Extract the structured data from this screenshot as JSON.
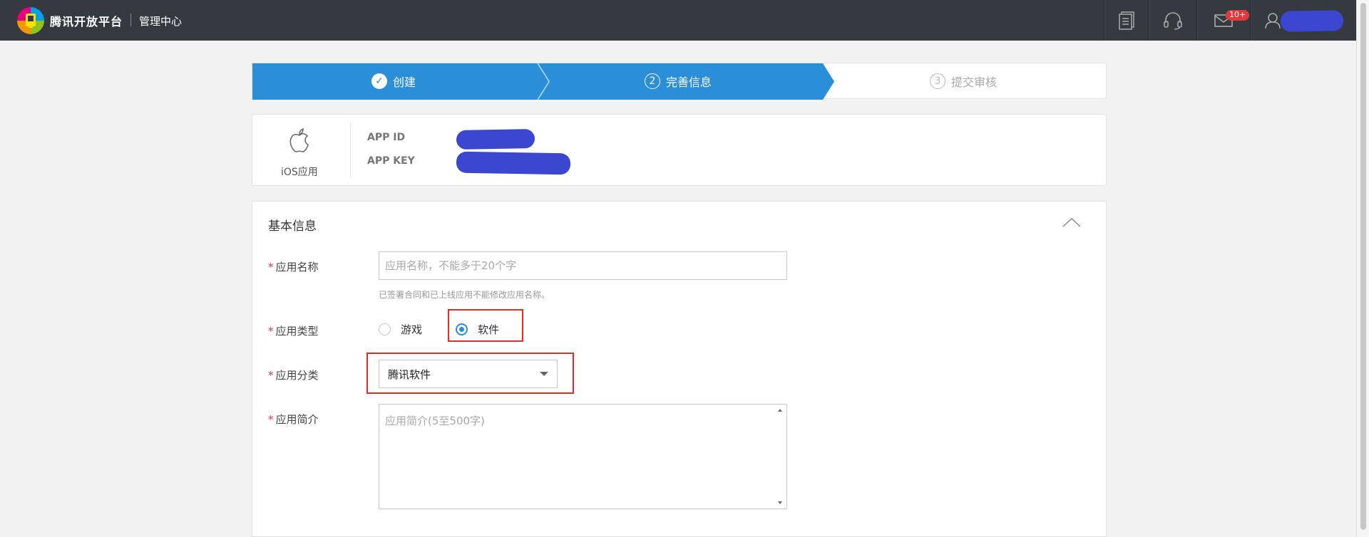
{
  "header": {
    "brand": "腾讯开放平台",
    "subtitle": "管理中心",
    "icons": [
      "document-icon",
      "headset-icon",
      "mail-icon",
      "user-icon"
    ],
    "mail_badge": "10+"
  },
  "steps": [
    {
      "label": "创建",
      "marker": "✓",
      "state": "done"
    },
    {
      "label": "完善信息",
      "marker": "2",
      "state": "active"
    },
    {
      "label": "提交审核",
      "marker": "3",
      "state": "pending"
    }
  ],
  "app": {
    "platform_label": "iOS应用",
    "app_id_label": "APP ID",
    "app_key_label": "APP KEY"
  },
  "basic_info": {
    "title": "基本信息",
    "required_mark": "*",
    "name": {
      "label": "应用名称",
      "placeholder": "应用名称，不能多于20个字",
      "value": "",
      "hint": "已签署合同和已上线应用不能修改应用名称。"
    },
    "type": {
      "label": "应用类型",
      "options": [
        {
          "label": "游戏",
          "selected": false
        },
        {
          "label": "软件",
          "selected": true
        }
      ]
    },
    "category": {
      "label": "应用分类",
      "selected": "腾讯软件"
    },
    "intro": {
      "label": "应用简介",
      "placeholder": "应用简介(5至500字)",
      "value": ""
    }
  },
  "colors": {
    "header_bg": "#353a40",
    "step_active": "#2b8ed8",
    "highlight_box": "#e5292f",
    "required": "#e4393c"
  }
}
